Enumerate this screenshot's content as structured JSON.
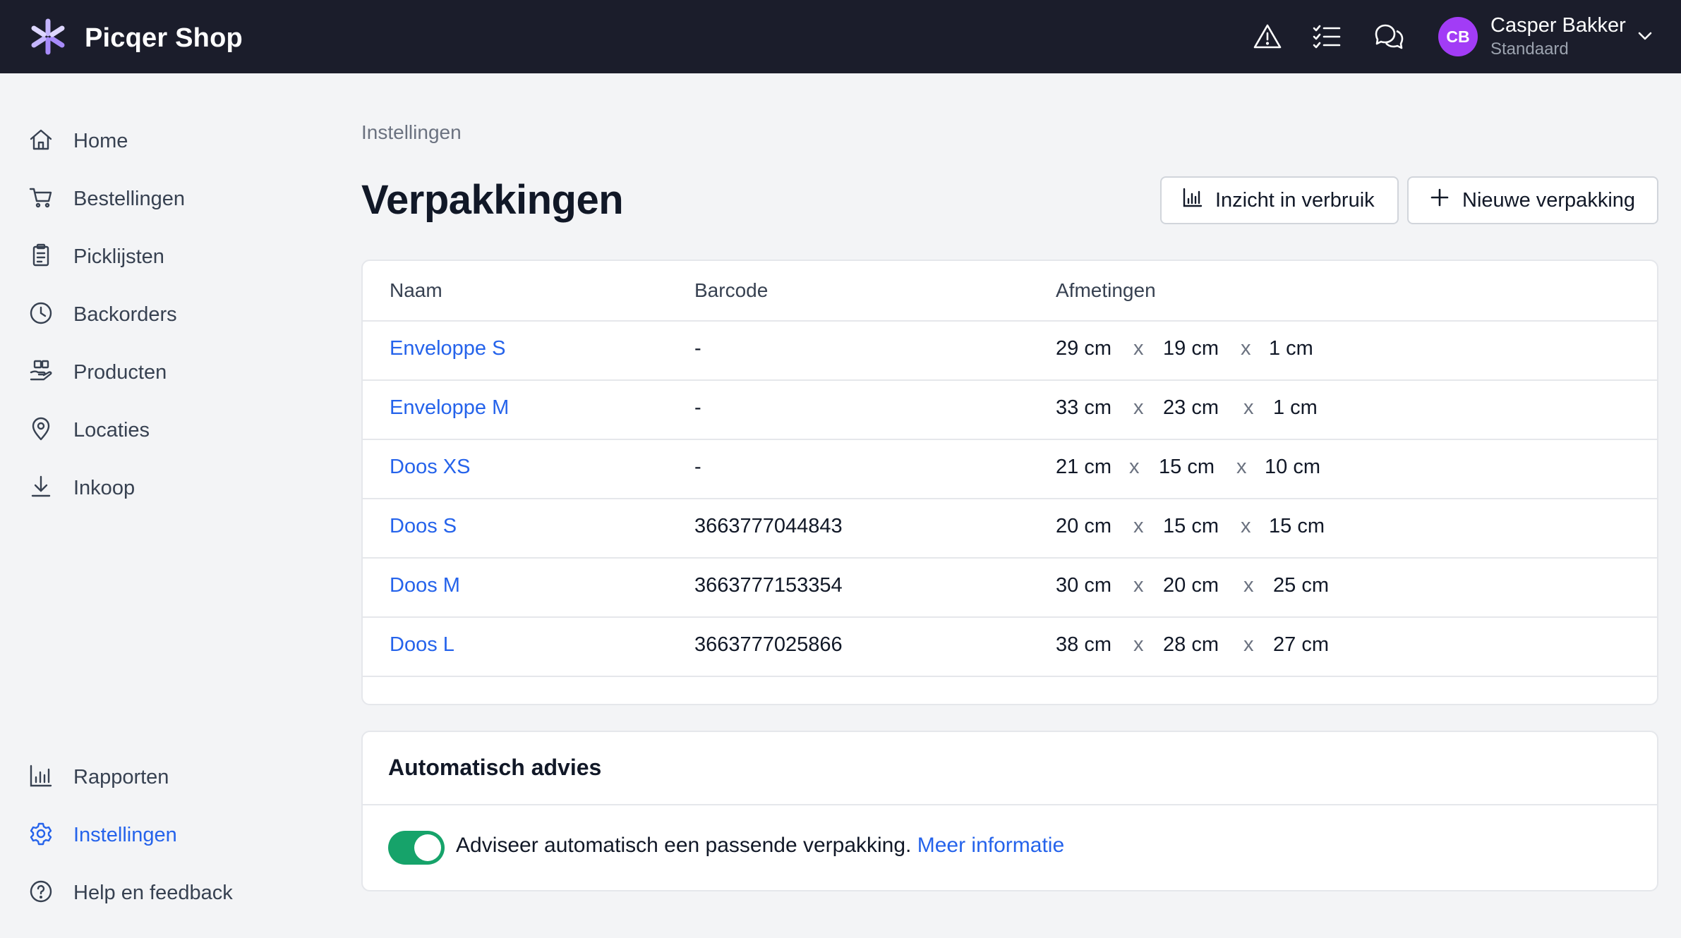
{
  "app": {
    "name": "Picqer Shop"
  },
  "user": {
    "initials": "CB",
    "name": "Casper Bakker",
    "role": "Standaard",
    "avatar_color": "#a23cf6"
  },
  "topbar": {
    "icons": [
      "warning-icon",
      "checklist-icon",
      "chat-icon"
    ]
  },
  "sidebar": {
    "items": [
      {
        "label": "Home",
        "icon": "home-icon"
      },
      {
        "label": "Bestellingen",
        "icon": "cart-icon"
      },
      {
        "label": "Picklijsten",
        "icon": "clipboard-icon"
      },
      {
        "label": "Backorders",
        "icon": "clock-icon"
      },
      {
        "label": "Producten",
        "icon": "products-icon"
      },
      {
        "label": "Locaties",
        "icon": "location-pin-icon"
      },
      {
        "label": "Inkoop",
        "icon": "download-icon"
      }
    ],
    "bottom_items": [
      {
        "label": "Rapporten",
        "icon": "bar-chart-icon"
      },
      {
        "label": "Instellingen",
        "icon": "settings-icon",
        "active": true
      },
      {
        "label": "Help en feedback",
        "icon": "help-icon"
      }
    ]
  },
  "breadcrumb": "Instellingen",
  "page_title": "Verpakkingen",
  "buttons": {
    "usage": "Inzicht in verbruik",
    "new": "Nieuwe verpakking"
  },
  "table": {
    "headers": {
      "name": "Naam",
      "barcode": "Barcode",
      "dimensions": "Afmetingen"
    },
    "separator": "x",
    "rows": [
      {
        "name": "Enveloppe S",
        "barcode": "-",
        "l": "29 cm",
        "w": "19 cm",
        "h": "1 cm"
      },
      {
        "name": "Enveloppe M",
        "barcode": "-",
        "l": "33 cm",
        "w": "23 cm",
        "h": "1 cm"
      },
      {
        "name": "Doos XS",
        "barcode": "-",
        "l": "21 cm",
        "w": "15 cm",
        "h": "10 cm"
      },
      {
        "name": "Doos S",
        "barcode": "3663777044843",
        "l": "20 cm",
        "w": "15 cm",
        "h": "15 cm"
      },
      {
        "name": "Doos M",
        "barcode": "3663777153354",
        "l": "30 cm",
        "w": "20 cm",
        "h": "25 cm"
      },
      {
        "name": "Doos L",
        "barcode": "3663777025866",
        "l": "38 cm",
        "w": "28 cm",
        "h": "27 cm"
      }
    ]
  },
  "advies": {
    "title": "Automatisch advies",
    "toggle_on": true,
    "text": "Adviseer automatisch een passende verpakking.",
    "link": "Meer informatie"
  },
  "colors": {
    "topbar": "#1b1d2b",
    "link": "#2563eb",
    "toggle": "#16a36a",
    "logo": "#a78bfa"
  }
}
